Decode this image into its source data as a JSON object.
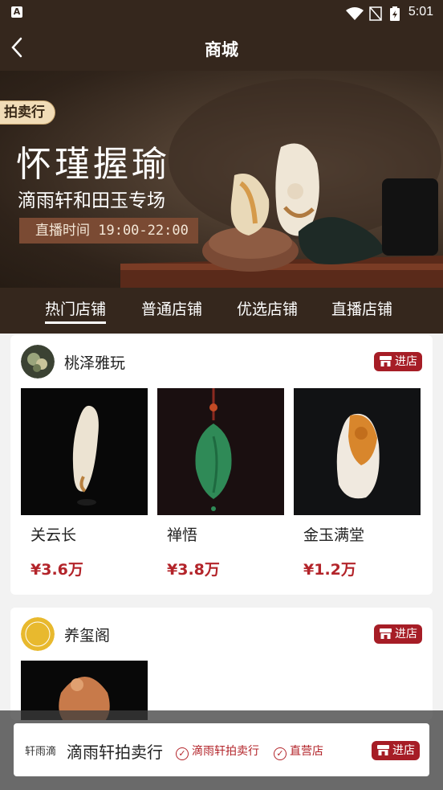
{
  "status": {
    "time": "5:01"
  },
  "nav": {
    "title": "商城"
  },
  "banner": {
    "badge": "拍卖行",
    "headline": "怀瑾握瑜",
    "subtitle": "滴雨轩和田玉专场",
    "live_time": "直播时间 19:00-22:00"
  },
  "tabs": [
    {
      "label": "热门店铺",
      "active": true
    },
    {
      "label": "普通店铺",
      "active": false
    },
    {
      "label": "优选店铺",
      "active": false
    },
    {
      "label": "直播店铺",
      "active": false
    }
  ],
  "shops": [
    {
      "name": "桃泽雅玩",
      "enter_label": "进店",
      "products": [
        {
          "name": "关云长",
          "price": "¥3.6万"
        },
        {
          "name": "禅悟",
          "price": "¥3.8万"
        },
        {
          "name": "金玉满堂",
          "price": "¥1.2万"
        }
      ]
    },
    {
      "name": "养玺阁",
      "enter_label": "进店"
    }
  ],
  "bottom_bar": {
    "logo_text": "轩雨滴",
    "name": "滴雨轩拍卖行",
    "tags": [
      "滴雨轩拍卖行",
      "直营店"
    ],
    "enter_label": "进店"
  }
}
